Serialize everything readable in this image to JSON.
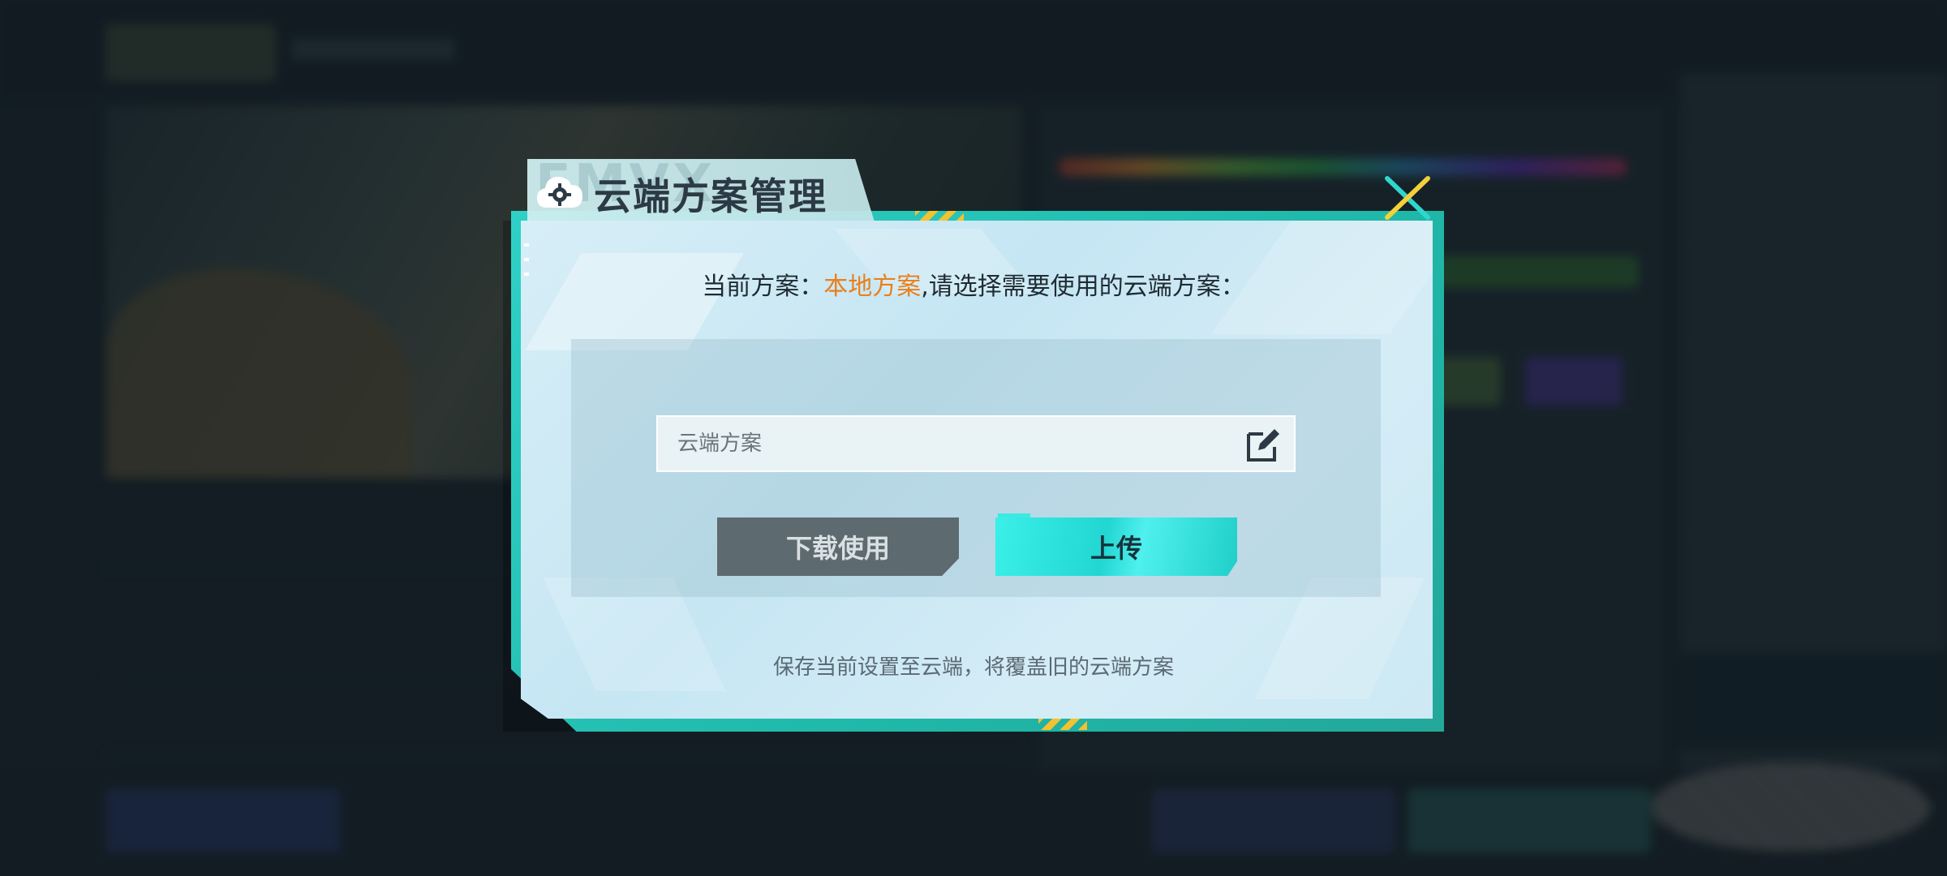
{
  "dialog": {
    "title": "云端方案管理",
    "header_ghost_text": "FMVX",
    "current_label": "当前方案：",
    "current_value": "本地方案",
    "current_suffix": ",请选择需要使用的云端方案：",
    "input": {
      "placeholder": "云端方案",
      "value": ""
    },
    "download_button": "下载使用",
    "upload_button": "上传",
    "hint": "保存当前设置至云端，将覆盖旧的云端方案"
  },
  "colors": {
    "accent_teal": "#2fd1c6",
    "highlight_orange": "#e8801c",
    "button_gray": "#5d6a70",
    "button_cyan": "#22d6d2"
  },
  "icons": {
    "title": "cloud-gear-icon",
    "close": "close-icon",
    "edit": "edit-icon"
  }
}
